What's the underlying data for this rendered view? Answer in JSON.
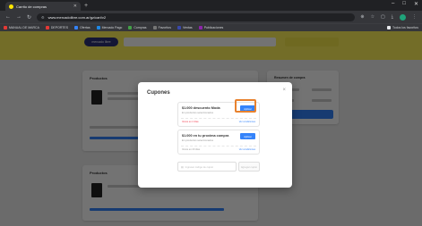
{
  "browser": {
    "tab_title": "Carrito de compras",
    "new_tab": "+",
    "url": "www.mercadolibre.com.ar/gz/cart/v2",
    "window_buttons": [
      "–",
      "□",
      "✕"
    ],
    "bookmarks": [
      {
        "label": "MANUAL DE MARCA",
        "color": "#e53935"
      },
      {
        "label": "DEPORTES",
        "color": "#e53935"
      },
      {
        "label": "Ofertas",
        "color": "#3483fa"
      },
      {
        "label": "Mercado Pago",
        "color": "#1e88e5"
      },
      {
        "label": "Compras",
        "color": "#43a047"
      },
      {
        "label": "Favoritos",
        "color": "#757575"
      },
      {
        "label": "Ventas",
        "color": "#3949ab"
      },
      {
        "label": "Publicaciones",
        "color": "#8e24aa"
      },
      {
        "label": "Todos los favoritos",
        "color": "#e8eaed"
      }
    ]
  },
  "page": {
    "logo": "mercado libre",
    "cart_title": "Productos",
    "cart_title_2": "Productos",
    "summary_title": "Resumen de compra"
  },
  "modal": {
    "title": "Cupones",
    "close": "×",
    "coupons": [
      {
        "title": "$1.000 descuento Moda",
        "subtitle": "En productos seleccionados",
        "button": "Aplicar",
        "expiry": "Vence en 2 días",
        "link": "Ver condiciones"
      },
      {
        "title": "$1.000 en tu proxima compra",
        "subtitle": "En productos seleccionados",
        "button": "Aplicar",
        "expiry": "Vence en 20 días",
        "link": "Ver condiciones"
      }
    ],
    "add_placeholder": "Ingresar código de cupón",
    "add_button": "Agregar cupón"
  },
  "colors": {
    "accent": "#3483fa",
    "brand_yellow": "#fff159",
    "highlight": "#e8822e"
  }
}
